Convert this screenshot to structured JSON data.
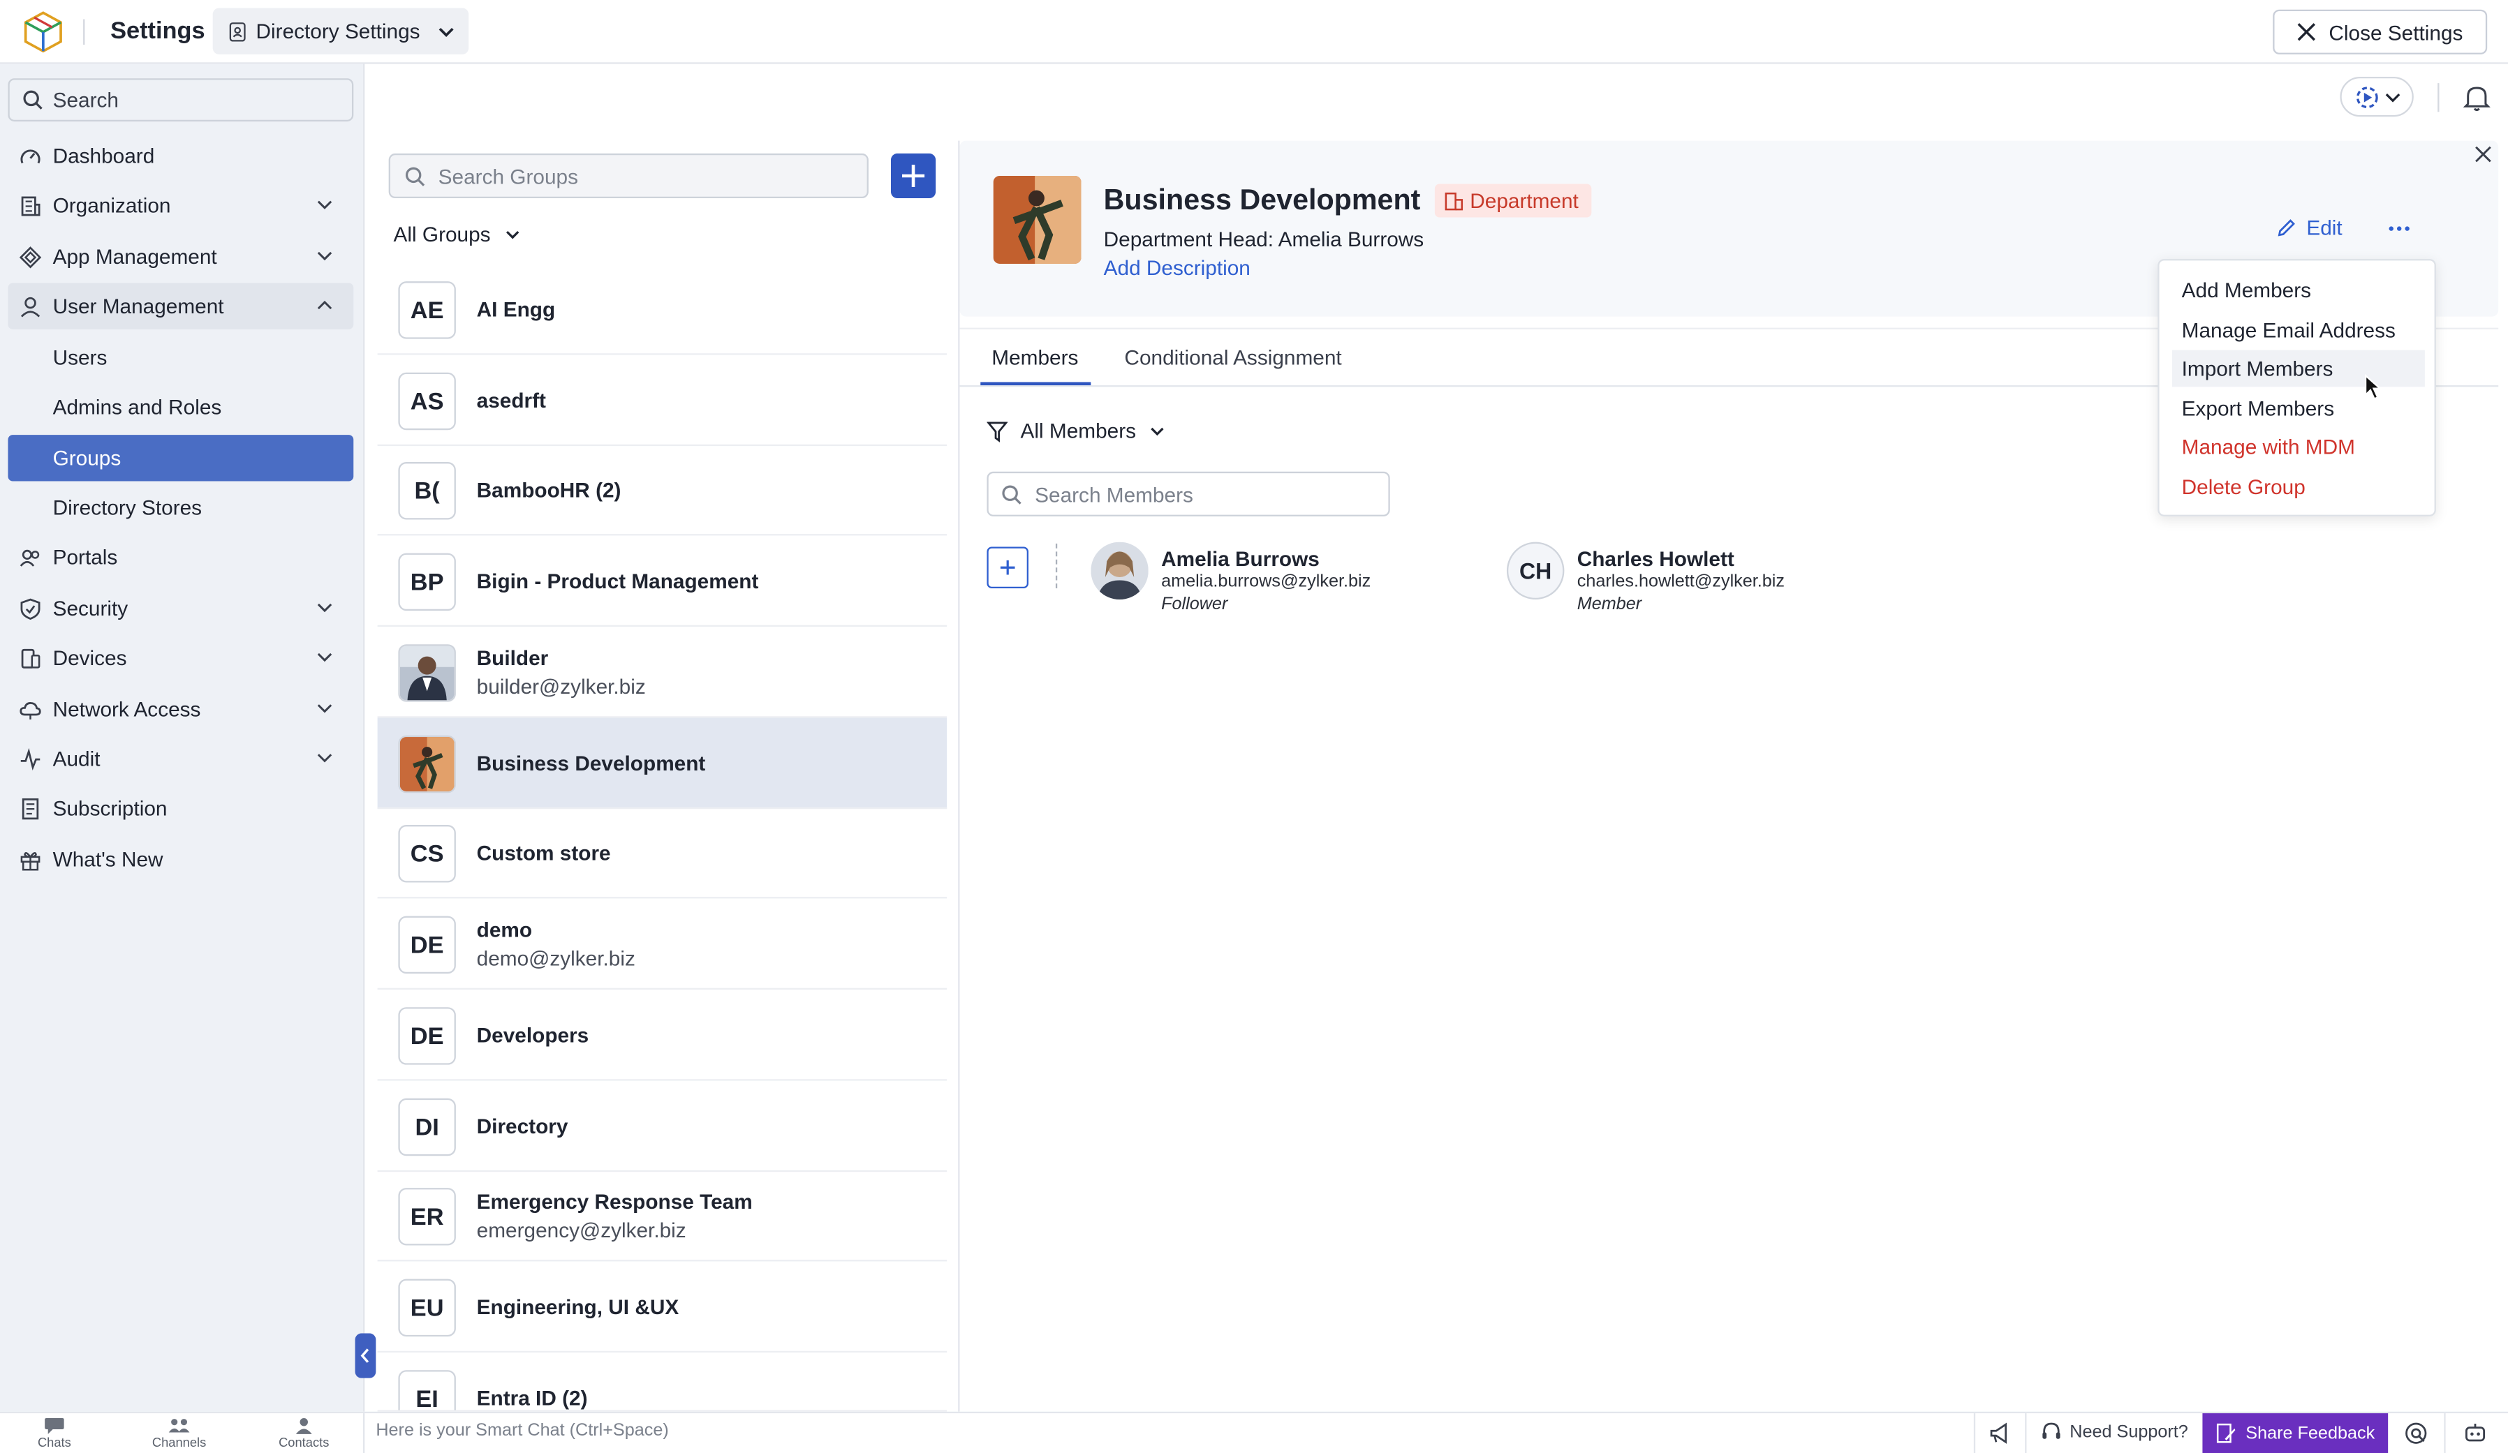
{
  "topbar": {
    "title": "Settings",
    "directory_dropdown": "Directory Settings",
    "close_label": "Close Settings"
  },
  "sidebar": {
    "search_placeholder": "Search",
    "items": [
      {
        "label": "Dashboard",
        "icon": "dashboard-icon"
      },
      {
        "label": "Organization",
        "icon": "building-icon",
        "expandable": true
      },
      {
        "label": "App Management",
        "icon": "apps-icon",
        "expandable": true
      },
      {
        "label": "User Management",
        "icon": "user-icon",
        "expandable": true,
        "expanded": true
      },
      {
        "label": "Users",
        "sub": true
      },
      {
        "label": "Admins and Roles",
        "sub": true
      },
      {
        "label": "Groups",
        "sub": true,
        "active": true
      },
      {
        "label": "Directory Stores",
        "sub": true
      },
      {
        "label": "Portals",
        "icon": "portal-icon"
      },
      {
        "label": "Security",
        "icon": "shield-icon",
        "expandable": true
      },
      {
        "label": "Devices",
        "icon": "device-icon",
        "expandable": true
      },
      {
        "label": "Network Access",
        "icon": "cloud-icon",
        "expandable": true
      },
      {
        "label": "Audit",
        "icon": "activity-icon",
        "expandable": true
      },
      {
        "label": "Subscription",
        "icon": "receipt-icon"
      },
      {
        "label": "What's New",
        "icon": "gift-icon"
      }
    ]
  },
  "groups": {
    "search_placeholder": "Search Groups",
    "filter_label": "All Groups",
    "list": [
      {
        "initials": "AE",
        "name": "AI Engg",
        "email": ""
      },
      {
        "initials": "AS",
        "name": "asedrft",
        "email": ""
      },
      {
        "initials": "B(",
        "name": "BambooHR (2)",
        "email": ""
      },
      {
        "initials": "BP",
        "name": "Bigin - Product Management",
        "email": ""
      },
      {
        "initials": "",
        "name": "Builder",
        "email": "builder@zylker.biz",
        "photo": true
      },
      {
        "initials": "",
        "name": "Business Development",
        "email": "",
        "photo": true,
        "selected": true
      },
      {
        "initials": "CS",
        "name": "Custom store",
        "email": ""
      },
      {
        "initials": "DE",
        "name": "demo",
        "email": "demo@zylker.biz"
      },
      {
        "initials": "DE",
        "name": "Developers",
        "email": ""
      },
      {
        "initials": "DI",
        "name": "Directory",
        "email": ""
      },
      {
        "initials": "ER",
        "name": "Emergency Response Team",
        "email": "emergency@zylker.biz"
      },
      {
        "initials": "EU",
        "name": "Engineering, UI &UX",
        "email": ""
      },
      {
        "initials": "EI",
        "name": "Entra ID (2)",
        "email": ""
      }
    ]
  },
  "detail": {
    "name": "Business Development",
    "badge": "Department",
    "head_label": "Department Head:",
    "head_name": "Amelia Burrows",
    "add_description": "Add Description",
    "edit_label": "Edit",
    "tabs": [
      "Members",
      "Conditional Assignment"
    ],
    "member_filter": "All Members",
    "member_search_placeholder": "Search Members",
    "members": [
      {
        "name": "Amelia Burrows",
        "email": "amelia.burrows@zylker.biz",
        "role": "Follower",
        "initials": ""
      },
      {
        "name": "Charles Howlett",
        "email": "charles.howlett@zylker.biz",
        "role": "Member",
        "initials": "CH"
      }
    ]
  },
  "menu": {
    "items": [
      {
        "label": "Add Members",
        "danger": false
      },
      {
        "label": "Manage Email Address",
        "danger": false
      },
      {
        "label": "Import Members",
        "danger": false,
        "hovered": true
      },
      {
        "label": "Export Members",
        "danger": false
      },
      {
        "label": "Manage with MDM",
        "danger": true
      },
      {
        "label": "Delete Group",
        "danger": true
      }
    ]
  },
  "bottombar": {
    "tabs": [
      "Chats",
      "Channels",
      "Contacts"
    ],
    "smart_chat": "Here is your Smart Chat (Ctrl+Space)",
    "support": "Need Support?",
    "feedback": "Share Feedback"
  },
  "colors": {
    "accent": "#2f56c0",
    "active_nav": "#4a6dc4",
    "danger": "#d0342c",
    "feedback": "#6a2fbf",
    "link": "#2f5fd0"
  }
}
